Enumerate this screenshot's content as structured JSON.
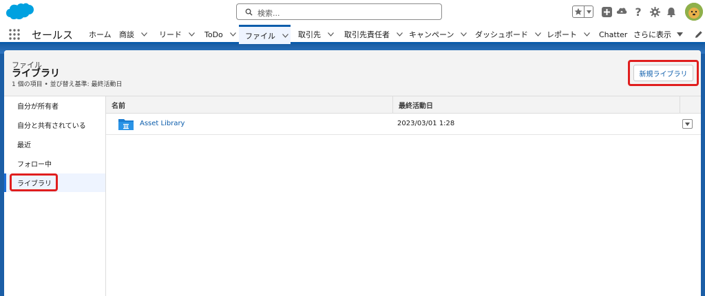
{
  "header": {
    "search_placeholder": "検索...",
    "icons": [
      "cloud-logo",
      "search-icon",
      "star-icon",
      "add-icon",
      "trailhead-icon",
      "help-icon",
      "gear-icon",
      "bell-icon",
      "avatar"
    ]
  },
  "nav": {
    "app_name": "セールス",
    "tabs": [
      {
        "label": "ホーム",
        "dropdown": false
      },
      {
        "label": "商談",
        "dropdown": true
      },
      {
        "label": "リード",
        "dropdown": true
      },
      {
        "label": "ToDo",
        "dropdown": true
      },
      {
        "label": "ファイル",
        "dropdown": true,
        "active": true
      },
      {
        "label": "取引先",
        "dropdown": true
      },
      {
        "label": "取引先責任者",
        "dropdown": true
      },
      {
        "label": "キャンペーン",
        "dropdown": true
      },
      {
        "label": "ダッシュボード",
        "dropdown": true
      },
      {
        "label": "レポート",
        "dropdown": true
      },
      {
        "label": "Chatter",
        "dropdown": false
      },
      {
        "label": "さらに表示",
        "dropdown": true
      }
    ]
  },
  "page": {
    "eyebrow": "ファイル",
    "title": "ライブラリ",
    "meta": "1 個の項目 • 並び替え基準: 最終活動日",
    "new_library_button": "新規ライブラリ"
  },
  "sidebar": {
    "items": [
      {
        "label": "自分が所有者"
      },
      {
        "label": "自分と共有されている"
      },
      {
        "label": "最近"
      },
      {
        "label": "フォロー中"
      },
      {
        "label": "ライブラリ",
        "active": true
      }
    ]
  },
  "grid": {
    "columns": [
      "名前",
      "最終活動日"
    ],
    "rows": [
      {
        "name": "Asset Library",
        "last_activity": "2023/03/01 1:28"
      }
    ]
  },
  "colors": {
    "brand_blue": "#0b5cab",
    "band_blue": "#1b5ea6",
    "highlight_red": "#e01e1e",
    "logo_blue": "#00a1e0"
  }
}
